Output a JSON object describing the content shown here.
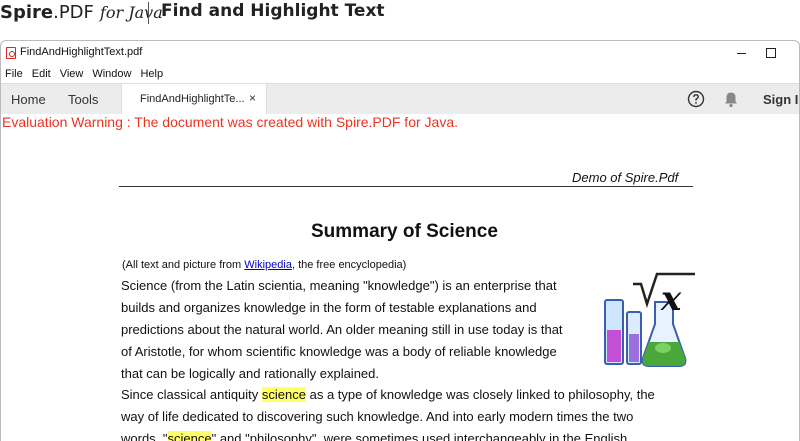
{
  "banner": {
    "brand_spire": "Spire",
    "brand_pdf": ".PDF",
    "brand_for_java": "for Java",
    "title": "Find and Highlight Text"
  },
  "window": {
    "title": "FindAndHighlightText.pdf"
  },
  "menu": [
    "File",
    "Edit",
    "View",
    "Window",
    "Help"
  ],
  "tabs": {
    "home": "Home",
    "tools": "Tools",
    "document": "FindAndHighlightTe...",
    "close": "×",
    "sign_in": "Sign I"
  },
  "document": {
    "warning": "Evaluation Warning : The document was created with Spire.PDF for Java.",
    "header_right": "Demo  of  Spire.Pdf",
    "title": "Summary of Science",
    "source_prefix": "(All text and picture from ",
    "source_link": "Wikipedia",
    "source_suffix": ", the free encyclopedia)",
    "lines": [
      "Science (from the Latin scientia, meaning \"knowledge\") is an enterprise that",
      "builds and organizes knowledge in the form of testable explanations and",
      "predictions about the natural world. An older meaning still in use today is that",
      "of Aristotle, for whom scientific knowledge was a body of reliable knowledge",
      "that can be logically and rationally explained."
    ],
    "line6_before": "Since classical antiquity ",
    "line6_highlight": "science",
    "line6_after": " as a type of knowledge was closely linked to philosophy, the",
    "line7": "way of life dedicated to discovering such knowledge. And into early modern times the two",
    "line8_before": "words, \"",
    "line8_highlight": "science",
    "line8_after": "\" and \"philosophy\", were sometimes used interchangeably in the English",
    "graphic_symbol": "x"
  },
  "colors": {
    "warning": "#ee3322",
    "highlight": "#ffff66",
    "link": "#0000cc"
  }
}
